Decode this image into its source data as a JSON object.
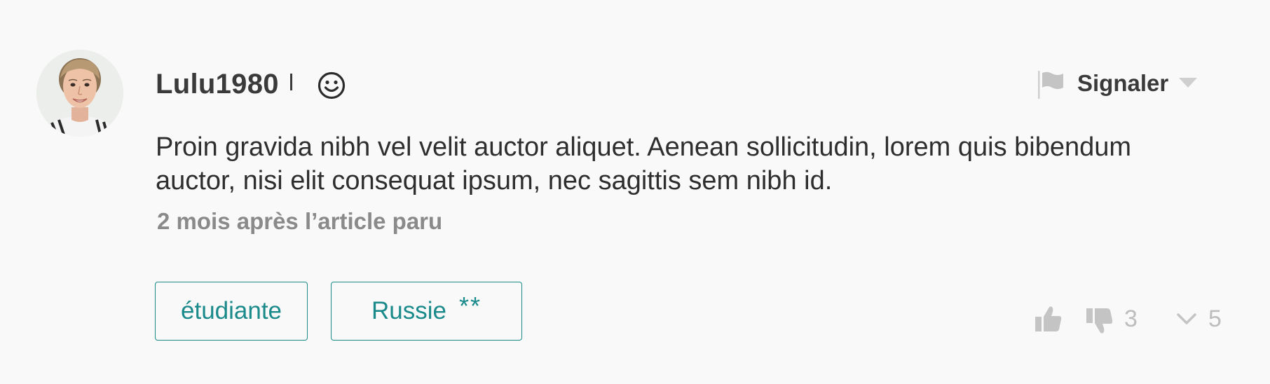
{
  "comment": {
    "author": {
      "username": "Lulu1980",
      "avatar_icon": "user-avatar-photo",
      "mood_icon": "smiley-face-icon"
    },
    "report": {
      "icon": "flag-icon",
      "label": "Signaler",
      "dropdown_icon": "chevron-down-icon"
    },
    "text": "Proin gravida nibh vel velit auctor aliquet. Aenean sollicitudin, lorem quis bibendum auctor, nisi elit consequat ipsum, nec sagittis sem nibh id.",
    "timestamp": "2 mois après l’article paru",
    "tags": [
      {
        "label": "étudiante",
        "stars": ""
      },
      {
        "label": "Russie",
        "stars": "**"
      }
    ],
    "votes": {
      "up_icon": "thumbs-up-icon",
      "down_icon": "thumbs-down-icon",
      "down_count": "3"
    },
    "replies": {
      "icon": "chevron-down-icon",
      "count": "5"
    }
  },
  "colors": {
    "background": "#f9f9f9",
    "accent": "#1b8a8a",
    "text": "#2e2e2e",
    "muted": "#8a8a8a",
    "icon_muted": "#bdbdbd"
  }
}
